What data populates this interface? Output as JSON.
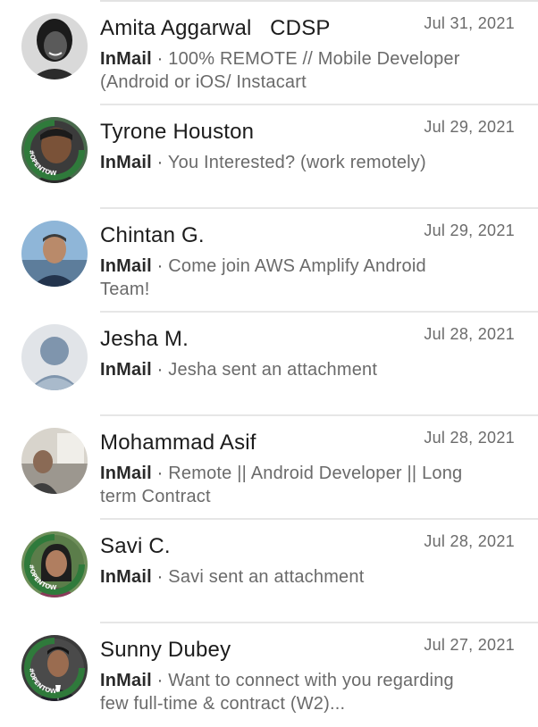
{
  "colors": {
    "open_to_work_ring": "#2f7a3b",
    "divider": "#e6e6e6",
    "date": "#6b6b6b",
    "snippet": "#6a6a6a"
  },
  "messages": [
    {
      "name": "Amita Aggarwal   CDSP",
      "date": "Jul 31, 2021",
      "tag": "InMail",
      "sep": "·",
      "snippet": "100% REMOTE // Mobile Developer (Android or iOS/ Instacart",
      "avatar": "photo",
      "open_to_work": false
    },
    {
      "name": "Tyrone Houston",
      "date": "Jul 29, 2021",
      "tag": "InMail",
      "sep": "·",
      "snippet": "You Interested? (work remotely)",
      "avatar": "photo",
      "open_to_work": true,
      "badge": "#OPENTOWORK"
    },
    {
      "name": "Chintan G.",
      "date": "Jul 29, 2021",
      "tag": "InMail",
      "sep": "·",
      "snippet": "Come join AWS Amplify Android Team!",
      "avatar": "photo",
      "open_to_work": false
    },
    {
      "name": "Jesha M.",
      "date": "Jul 28, 2021",
      "tag": "InMail",
      "sep": "·",
      "snippet": "Jesha sent an attachment",
      "avatar": "default-person-icon",
      "open_to_work": false
    },
    {
      "name": "Mohammad Asif",
      "date": "Jul 28, 2021",
      "tag": "InMail",
      "sep": "·",
      "snippet": "Remote || Android Developer  || Long term Contract",
      "avatar": "photo",
      "open_to_work": false
    },
    {
      "name": "Savi C.",
      "date": "Jul 28, 2021",
      "tag": "InMail",
      "sep": "·",
      "snippet": "Savi sent an attachment",
      "avatar": "photo",
      "open_to_work": true,
      "badge": "#OPENTOWORK"
    },
    {
      "name": "Sunny Dubey",
      "date": "Jul 27, 2021",
      "tag": "InMail",
      "sep": "·",
      "snippet": "Want to connect with you regarding few full-time & contract (W2)...",
      "avatar": "photo",
      "open_to_work": true,
      "badge": "#OPENTOWORK"
    }
  ]
}
